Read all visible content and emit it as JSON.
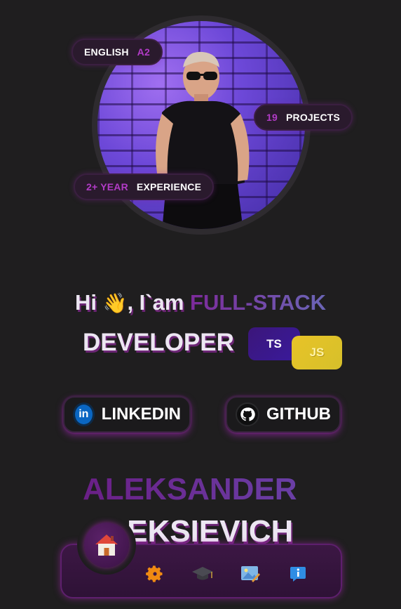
{
  "badges": {
    "english": {
      "label": "ENGLISH",
      "value": "A2"
    },
    "projects": {
      "value": "19",
      "label": "PROJECTS"
    },
    "experience": {
      "value": "2+ YEAR",
      "label": "EXPERIENCE"
    }
  },
  "hero": {
    "greeting": "Hi",
    "wave": "👋",
    "intro": ", I`am",
    "role_accent": "FULL-STACK",
    "role_main": "DEVELOPER",
    "tech_chips": [
      "TS",
      "JS"
    ]
  },
  "social": {
    "linkedin": {
      "label": "LINKEDIN",
      "icon": "linkedin-icon",
      "icon_text": "in"
    },
    "github": {
      "label": "GITHUB",
      "icon": "github-icon"
    }
  },
  "name": {
    "first": "ALEKSANDER",
    "last": "OLEKSIEVICH"
  },
  "dock": {
    "items": [
      {
        "icon": "home-icon",
        "active": true
      },
      {
        "icon": "gear-icon"
      },
      {
        "icon": "graduation-cap-icon"
      },
      {
        "icon": "gallery-icon"
      },
      {
        "icon": "info-icon"
      }
    ]
  },
  "colors": {
    "background": "#1f1e1f",
    "accent_purple": "#b23bc7",
    "glow": "#aa28be",
    "ts_chip": "#3b167a",
    "js_chip": "#e8c328"
  }
}
